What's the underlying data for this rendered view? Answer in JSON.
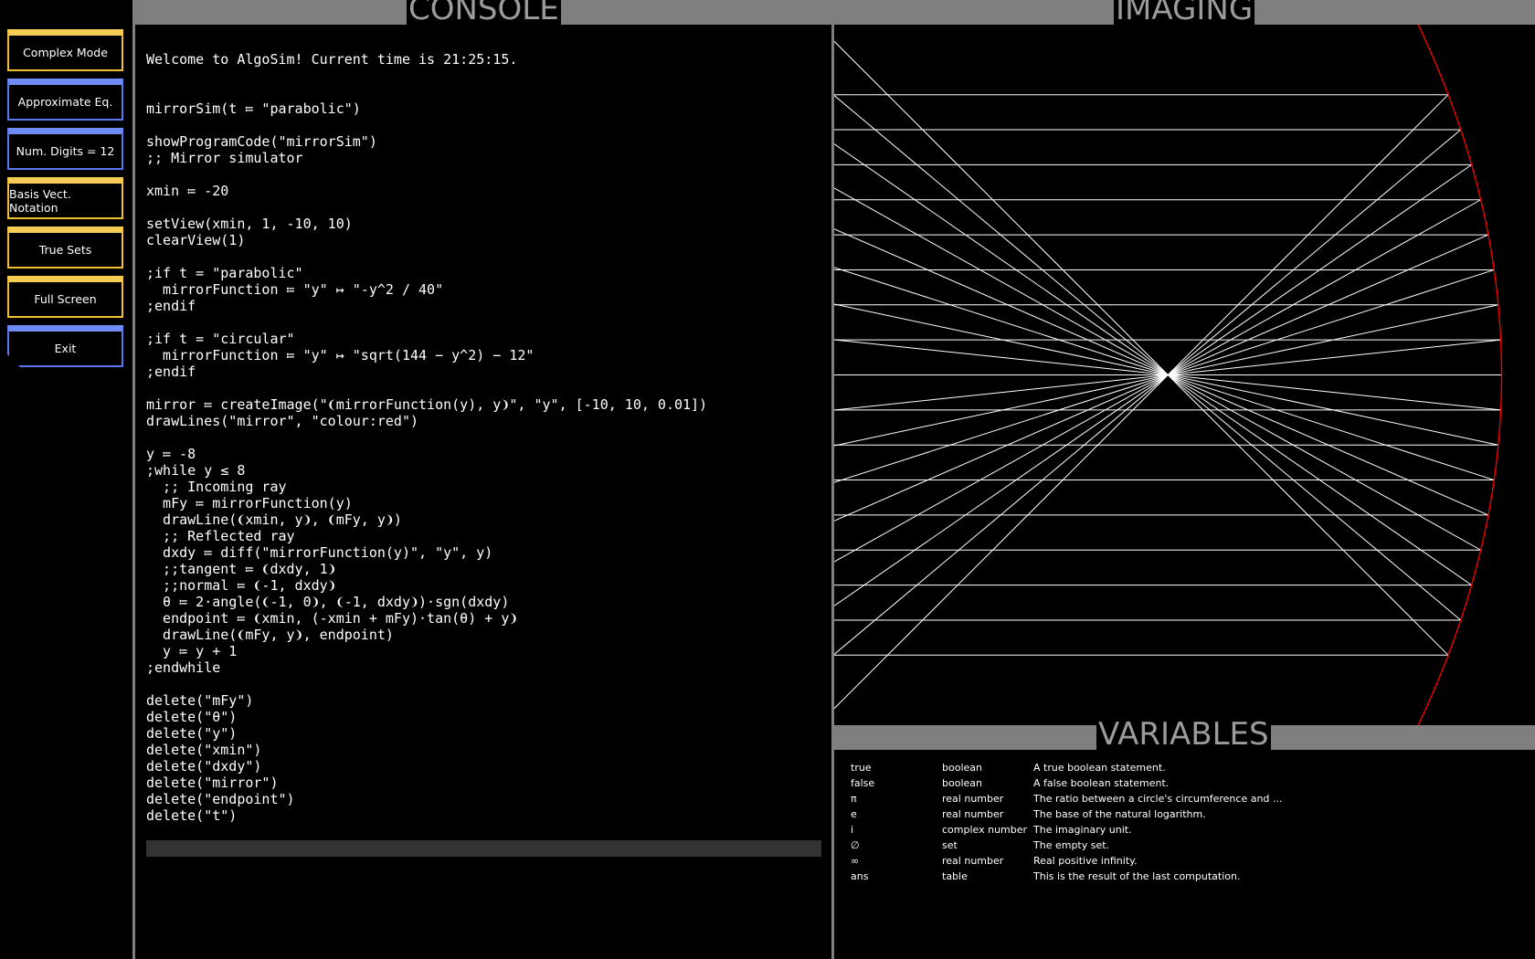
{
  "sidebar": {
    "buttons": [
      {
        "label": "Complex Mode",
        "color": "#f5cd54"
      },
      {
        "label": "Approximate Eq.",
        "color": "#6f8cf5"
      },
      {
        "label": "Num. Digits = 12",
        "color": "#6f8cf5"
      },
      {
        "label": "Basis Vect. Notation",
        "color": "#f5cd54"
      },
      {
        "label": "True Sets",
        "color": "#f5cd54"
      },
      {
        "label": "Full Screen",
        "color": "#f5cd54"
      },
      {
        "label": "Exit",
        "color": "#6f8cf5"
      }
    ]
  },
  "console": {
    "title": "CONSOLE",
    "lines": [
      "Welcome to AlgoSim! Current time is 21:25:15.",
      "",
      "",
      "mirrorSim(t ≔ \"parabolic\")",
      "",
      "showProgramCode(\"mirrorSim\")",
      ";; Mirror simulator",
      "",
      "xmin ≔ -20",
      "",
      "setView(xmin, 1, -10, 10)",
      "clearView(1)",
      "",
      ";if t = \"parabolic\"",
      "  mirrorFunction ≔ \"y\" ↦ \"-y^2 / 40\"",
      ";endif",
      "",
      ";if t = \"circular\"",
      "  mirrorFunction ≔ \"y\" ↦ \"sqrt(144 − y^2) − 12\"",
      ";endif",
      "",
      "mirror ≔ createImage(\"❨mirrorFunction(y), y❩\", \"y\", [-10, 10, 0.01])",
      "drawLines(\"mirror\", \"colour:red\")",
      "",
      "y ≔ -8",
      ";while y ≤ 8",
      "  ;; Incoming ray",
      "  mFy ≔ mirrorFunction(y)",
      "  drawLine(❨xmin, y❩, ❨mFy, y❩)",
      "  ;; Reflected ray",
      "  dxdy ≔ diff(\"mirrorFunction(y)\", \"y\", y)",
      "  ;;tangent ≔ ❨dxdy, 1❩",
      "  ;;normal ≔ ❨-1, dxdy❩",
      "  θ ≔ 2⋅angle(❨-1, 0❩, ❨-1, dxdy❩)⋅sgn(dxdy)",
      "  endpoint ≔ ❨xmin, (-xmin + mFy)⋅tan(θ) + y❩",
      "  drawLine(❨mFy, y❩, endpoint)",
      "  y ≔ y + 1",
      ";endwhile",
      "",
      "delete(\"mFy\")",
      "delete(\"θ\")",
      "delete(\"y\")",
      "delete(\"xmin\")",
      "delete(\"dxdy\")",
      "delete(\"mirror\")",
      "delete(\"endpoint\")",
      "delete(\"t\")"
    ],
    "input_value": ""
  },
  "imaging": {
    "title": "IMAGING",
    "view": {
      "xmin": -20,
      "xmax": 1,
      "ymin": -10,
      "ymax": 10
    },
    "mirror": {
      "function": "-y^2 / 40",
      "colour": "#ff0000",
      "y_range": [
        -10,
        10
      ]
    },
    "rays": {
      "y_start": -8,
      "y_end": 8,
      "step": 1,
      "colour": "#ffffff"
    }
  },
  "variables": {
    "title": "VARIABLES",
    "rows": [
      {
        "name": "true",
        "type": "boolean",
        "description": "A true boolean statement."
      },
      {
        "name": "false",
        "type": "boolean",
        "description": "A false boolean statement."
      },
      {
        "name": "π",
        "type": "real number",
        "description": "The ratio between a circle's circumference and ..."
      },
      {
        "name": "e",
        "type": "real number",
        "description": "The base of the natural logarithm."
      },
      {
        "name": "i",
        "type": "complex number",
        "description": "The imaginary unit."
      },
      {
        "name": "∅",
        "type": "set",
        "description": "The empty set."
      },
      {
        "name": "∞",
        "type": "real number",
        "description": "Real positive infinity."
      },
      {
        "name": "ans",
        "type": "table",
        "description": "This is the result of the last computation."
      }
    ]
  }
}
